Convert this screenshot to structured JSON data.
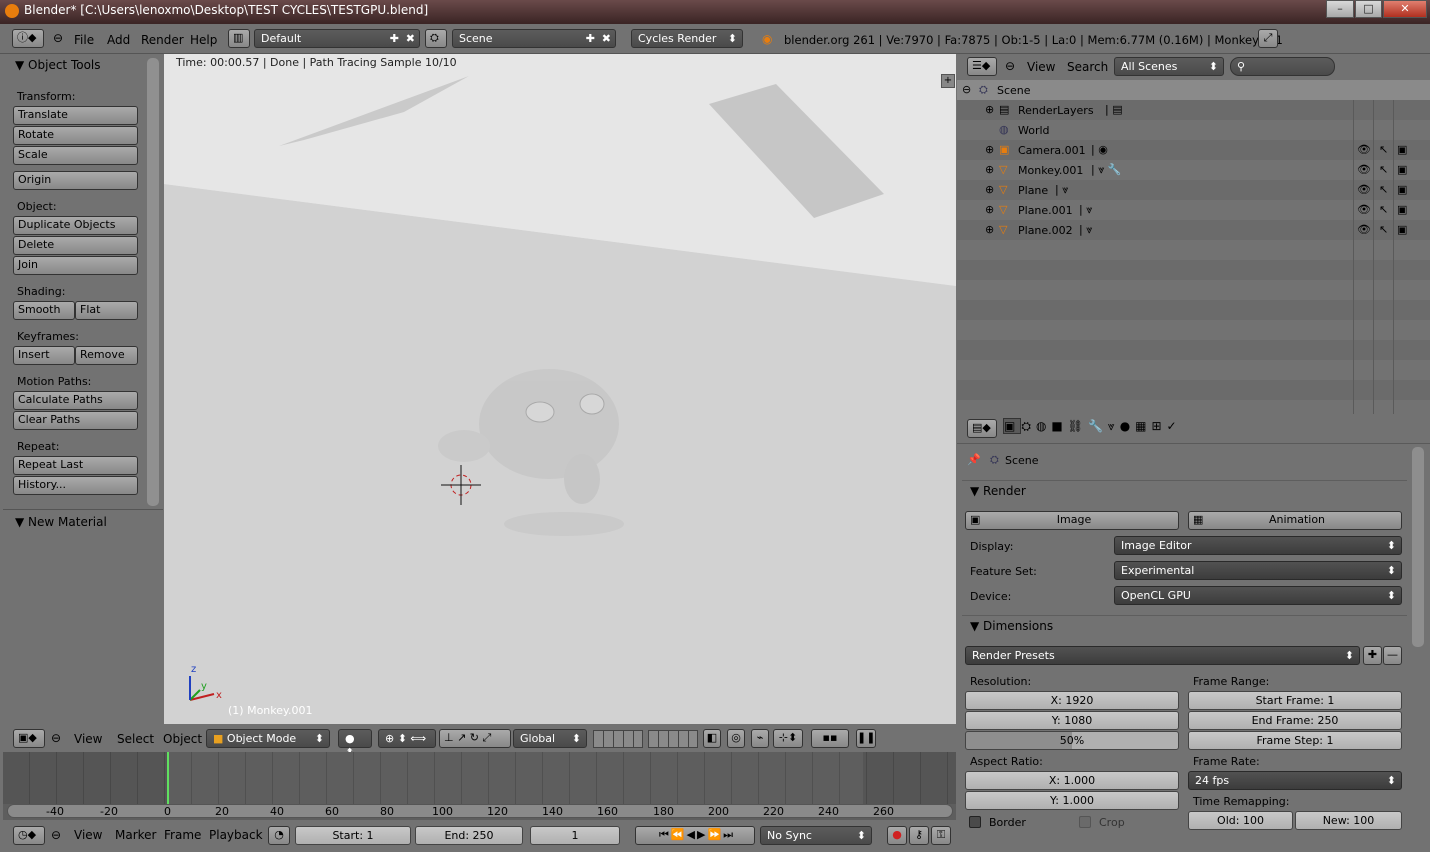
{
  "window": {
    "title": "Blender* [C:\\Users\\lenoxmo\\Desktop\\TEST CYCLES\\TESTGPU.blend]"
  },
  "menubar": {
    "menus": [
      "File",
      "Add",
      "Render",
      "Help"
    ],
    "layout": "Default",
    "scene": "Scene",
    "engine": "Cycles Render",
    "stats": "blender.org 261 | Ve:7970 | Fa:7875 | Ob:1-5 | La:0 | Mem:6.77M (0.16M) | Monkey.001"
  },
  "tools": {
    "header": "Object Tools",
    "transform_label": "Transform:",
    "translate": "Translate",
    "rotate": "Rotate",
    "scale": "Scale",
    "origin": "Origin",
    "object_label": "Object:",
    "duplicate": "Duplicate Objects",
    "delete": "Delete",
    "join": "Join",
    "shading_label": "Shading:",
    "smooth": "Smooth",
    "flat": "Flat",
    "keyframes_label": "Keyframes:",
    "insert": "Insert",
    "remove": "Remove",
    "motion_label": "Motion Paths:",
    "calc_paths": "Calculate Paths",
    "clear_paths": "Clear Paths",
    "repeat_label": "Repeat:",
    "repeat_last": "Repeat Last",
    "history": "History...",
    "new_material": "New Material"
  },
  "viewport": {
    "status": "Time: 00:00.57 | Done | Path Tracing Sample 10/10",
    "object_label": "(1) Monkey.001",
    "axis_z": "z",
    "axis_y": "y",
    "axis_x": "x"
  },
  "viewheader": {
    "menus": [
      "View",
      "Select",
      "Object"
    ],
    "mode": "Object Mode",
    "orientation": "Global"
  },
  "outliner": {
    "menus": [
      "View",
      "Search"
    ],
    "filter": "All Scenes",
    "items": [
      "Scene",
      "RenderLayers",
      "World",
      "Camera.001",
      "Monkey.001",
      "Plane",
      "Plane.001",
      "Plane.002"
    ]
  },
  "properties": {
    "context": "Scene",
    "render_panel": "Render",
    "image_btn": "Image",
    "animation_btn": "Animation",
    "display_label": "Display:",
    "display_value": "Image Editor",
    "feature_label": "Feature Set:",
    "feature_value": "Experimental",
    "device_label": "Device:",
    "device_value": "OpenCL GPU",
    "dimensions_panel": "Dimensions",
    "presets": "Render Presets",
    "resolution_label": "Resolution:",
    "res_x": "X: 1920",
    "res_y": "Y: 1080",
    "res_pct": "50%",
    "frame_range_label": "Frame Range:",
    "start_frame": "Start Frame: 1",
    "end_frame": "End Frame: 250",
    "frame_step": "Frame Step: 1",
    "aspect_label": "Aspect Ratio:",
    "aspect_x": "X: 1.000",
    "aspect_y": "Y: 1.000",
    "frame_rate_label": "Frame Rate:",
    "frame_rate": "24 fps",
    "time_remap_label": "Time Remapping:",
    "old": "Old: 100",
    "new": "New: 100",
    "border": "Border",
    "crop": "Crop"
  },
  "timeline": {
    "ticks": [
      "-40",
      "-20",
      "0",
      "20",
      "40",
      "60",
      "80",
      "100",
      "120",
      "140",
      "160",
      "180",
      "200",
      "220",
      "240",
      "260"
    ],
    "menus": [
      "View",
      "Marker",
      "Frame",
      "Playback"
    ],
    "start": "Start: 1",
    "end": "End: 250",
    "current": "1",
    "sync": "No Sync"
  }
}
